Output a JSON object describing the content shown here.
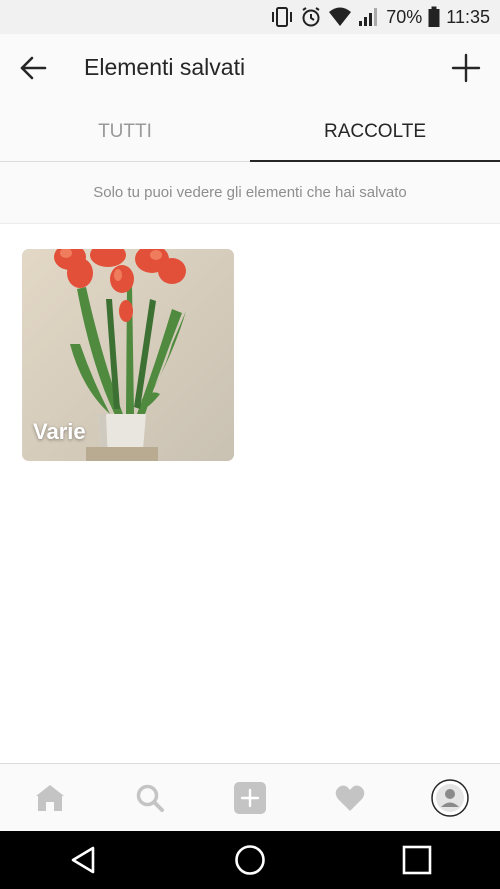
{
  "status_bar": {
    "battery_percent": "70%",
    "time": "11:35",
    "icons": [
      "vibrate-icon",
      "alarm-icon",
      "wifi-icon",
      "signal-icon",
      "battery-icon"
    ]
  },
  "app_bar": {
    "title": "Elementi salvati",
    "back_icon": "arrow-left-icon",
    "add_icon": "plus-icon"
  },
  "tabs": [
    {
      "label": "TUTTI",
      "active": false
    },
    {
      "label": "RACCOLTE",
      "active": true
    }
  ],
  "notice": "Solo tu puoi vedere gli elementi che hai salvato",
  "collections": [
    {
      "name": "Varie",
      "thumbnail": "red tulips in white vase"
    }
  ],
  "bottom_nav": [
    "home-icon",
    "search-icon",
    "add-post-icon",
    "heart-icon",
    "profile-avatar"
  ],
  "system_nav": [
    "back-triangle-icon",
    "home-circle-icon",
    "recents-square-icon"
  ],
  "colors": {
    "bar_background": "#fafafa",
    "text_primary": "#262626",
    "text_secondary": "#8e8e8e",
    "nav_icon": "#c4c4c4"
  }
}
